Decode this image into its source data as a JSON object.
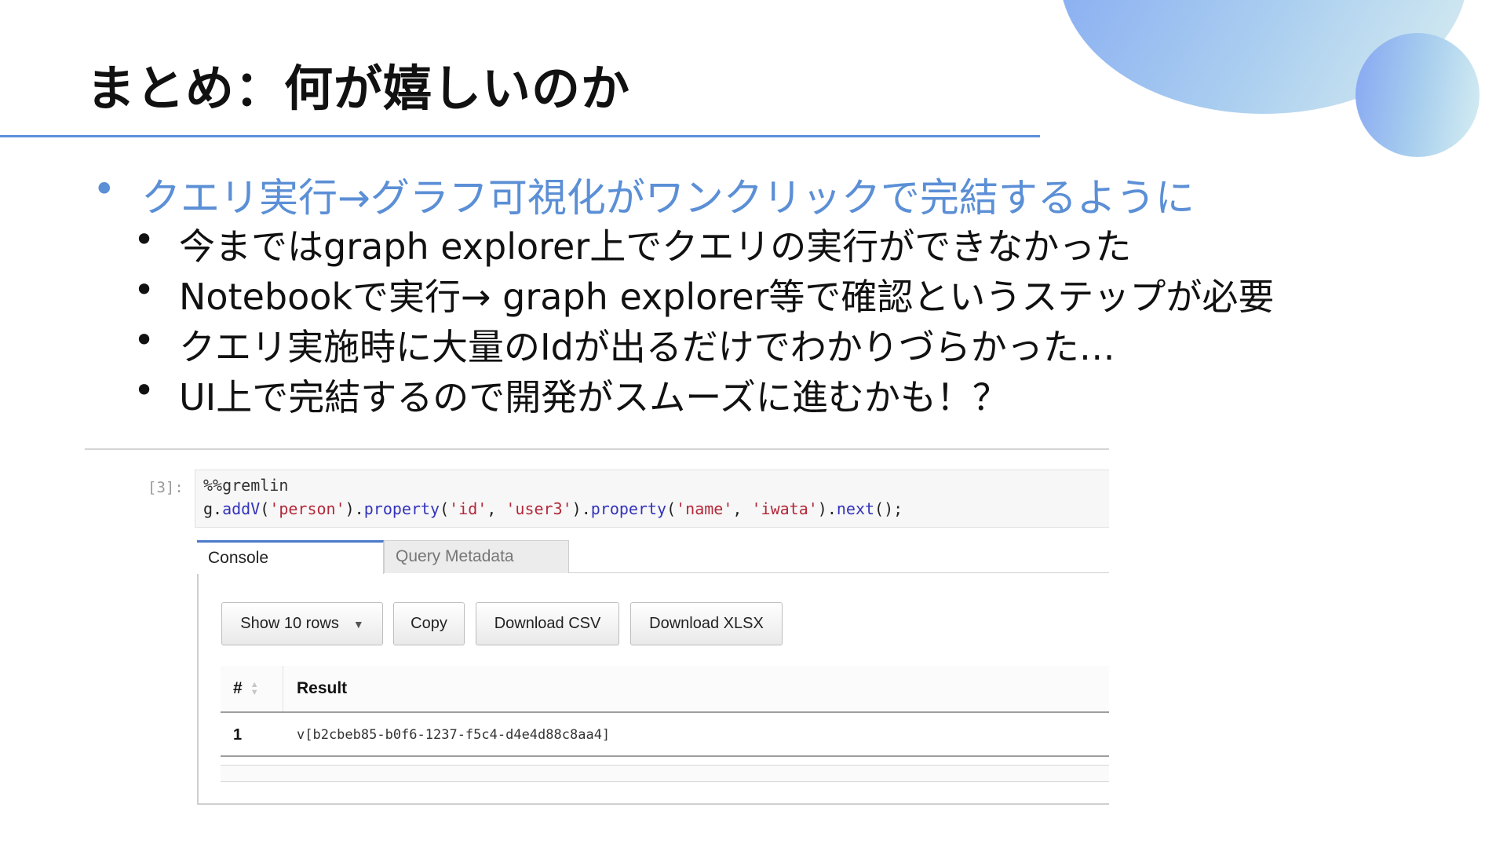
{
  "slide": {
    "title": "まとめ：何が嬉しいのか",
    "bullet_main": "クエリ実行→グラフ可視化がワンクリックで完結するように",
    "bullet_symbol": "•",
    "sub_bullets": [
      "今まではgraph explorer上でクエリの実行ができなかった",
      "Notebookで実行→ graph explorer等で確認というステップが必要",
      "クエリ実施時に大量のIdが出るだけでわかりづらかった…",
      "UI上で完結するので開発がスムーズに進むかも！？"
    ]
  },
  "notebook": {
    "prompt": "[3]:",
    "code": {
      "magic": "%%gremlin",
      "l2_g": "g.",
      "l2_addV": "addV",
      "l2_p1": "(",
      "l2_s1": "'person'",
      "l2_p2": ").",
      "l2_prop1": "property",
      "l2_p3": "(",
      "l2_s2": "'id'",
      "l2_p4": ", ",
      "l2_s3": "'user3'",
      "l2_p5": ").",
      "l2_prop2": "property",
      "l2_p6": "(",
      "l2_s4": "'name'",
      "l2_p7": ", ",
      "l2_s5": "'iwata'",
      "l2_p8": ").",
      "l2_next": "next",
      "l2_p9": "();"
    },
    "tabs": [
      {
        "label": "Console"
      },
      {
        "label": "Query Metadata"
      }
    ],
    "buttons": {
      "show_rows": "Show 10 rows",
      "caret": "▼",
      "copy": "Copy",
      "download_csv": "Download CSV",
      "download_xlsx": "Download XLSX"
    },
    "table": {
      "headers": [
        "#",
        "Result"
      ],
      "rows": [
        {
          "num": "1",
          "result": "v[b2cbeb85-b0f6-1237-f5c4-d4e4d88c8aa4]"
        }
      ]
    }
  }
}
